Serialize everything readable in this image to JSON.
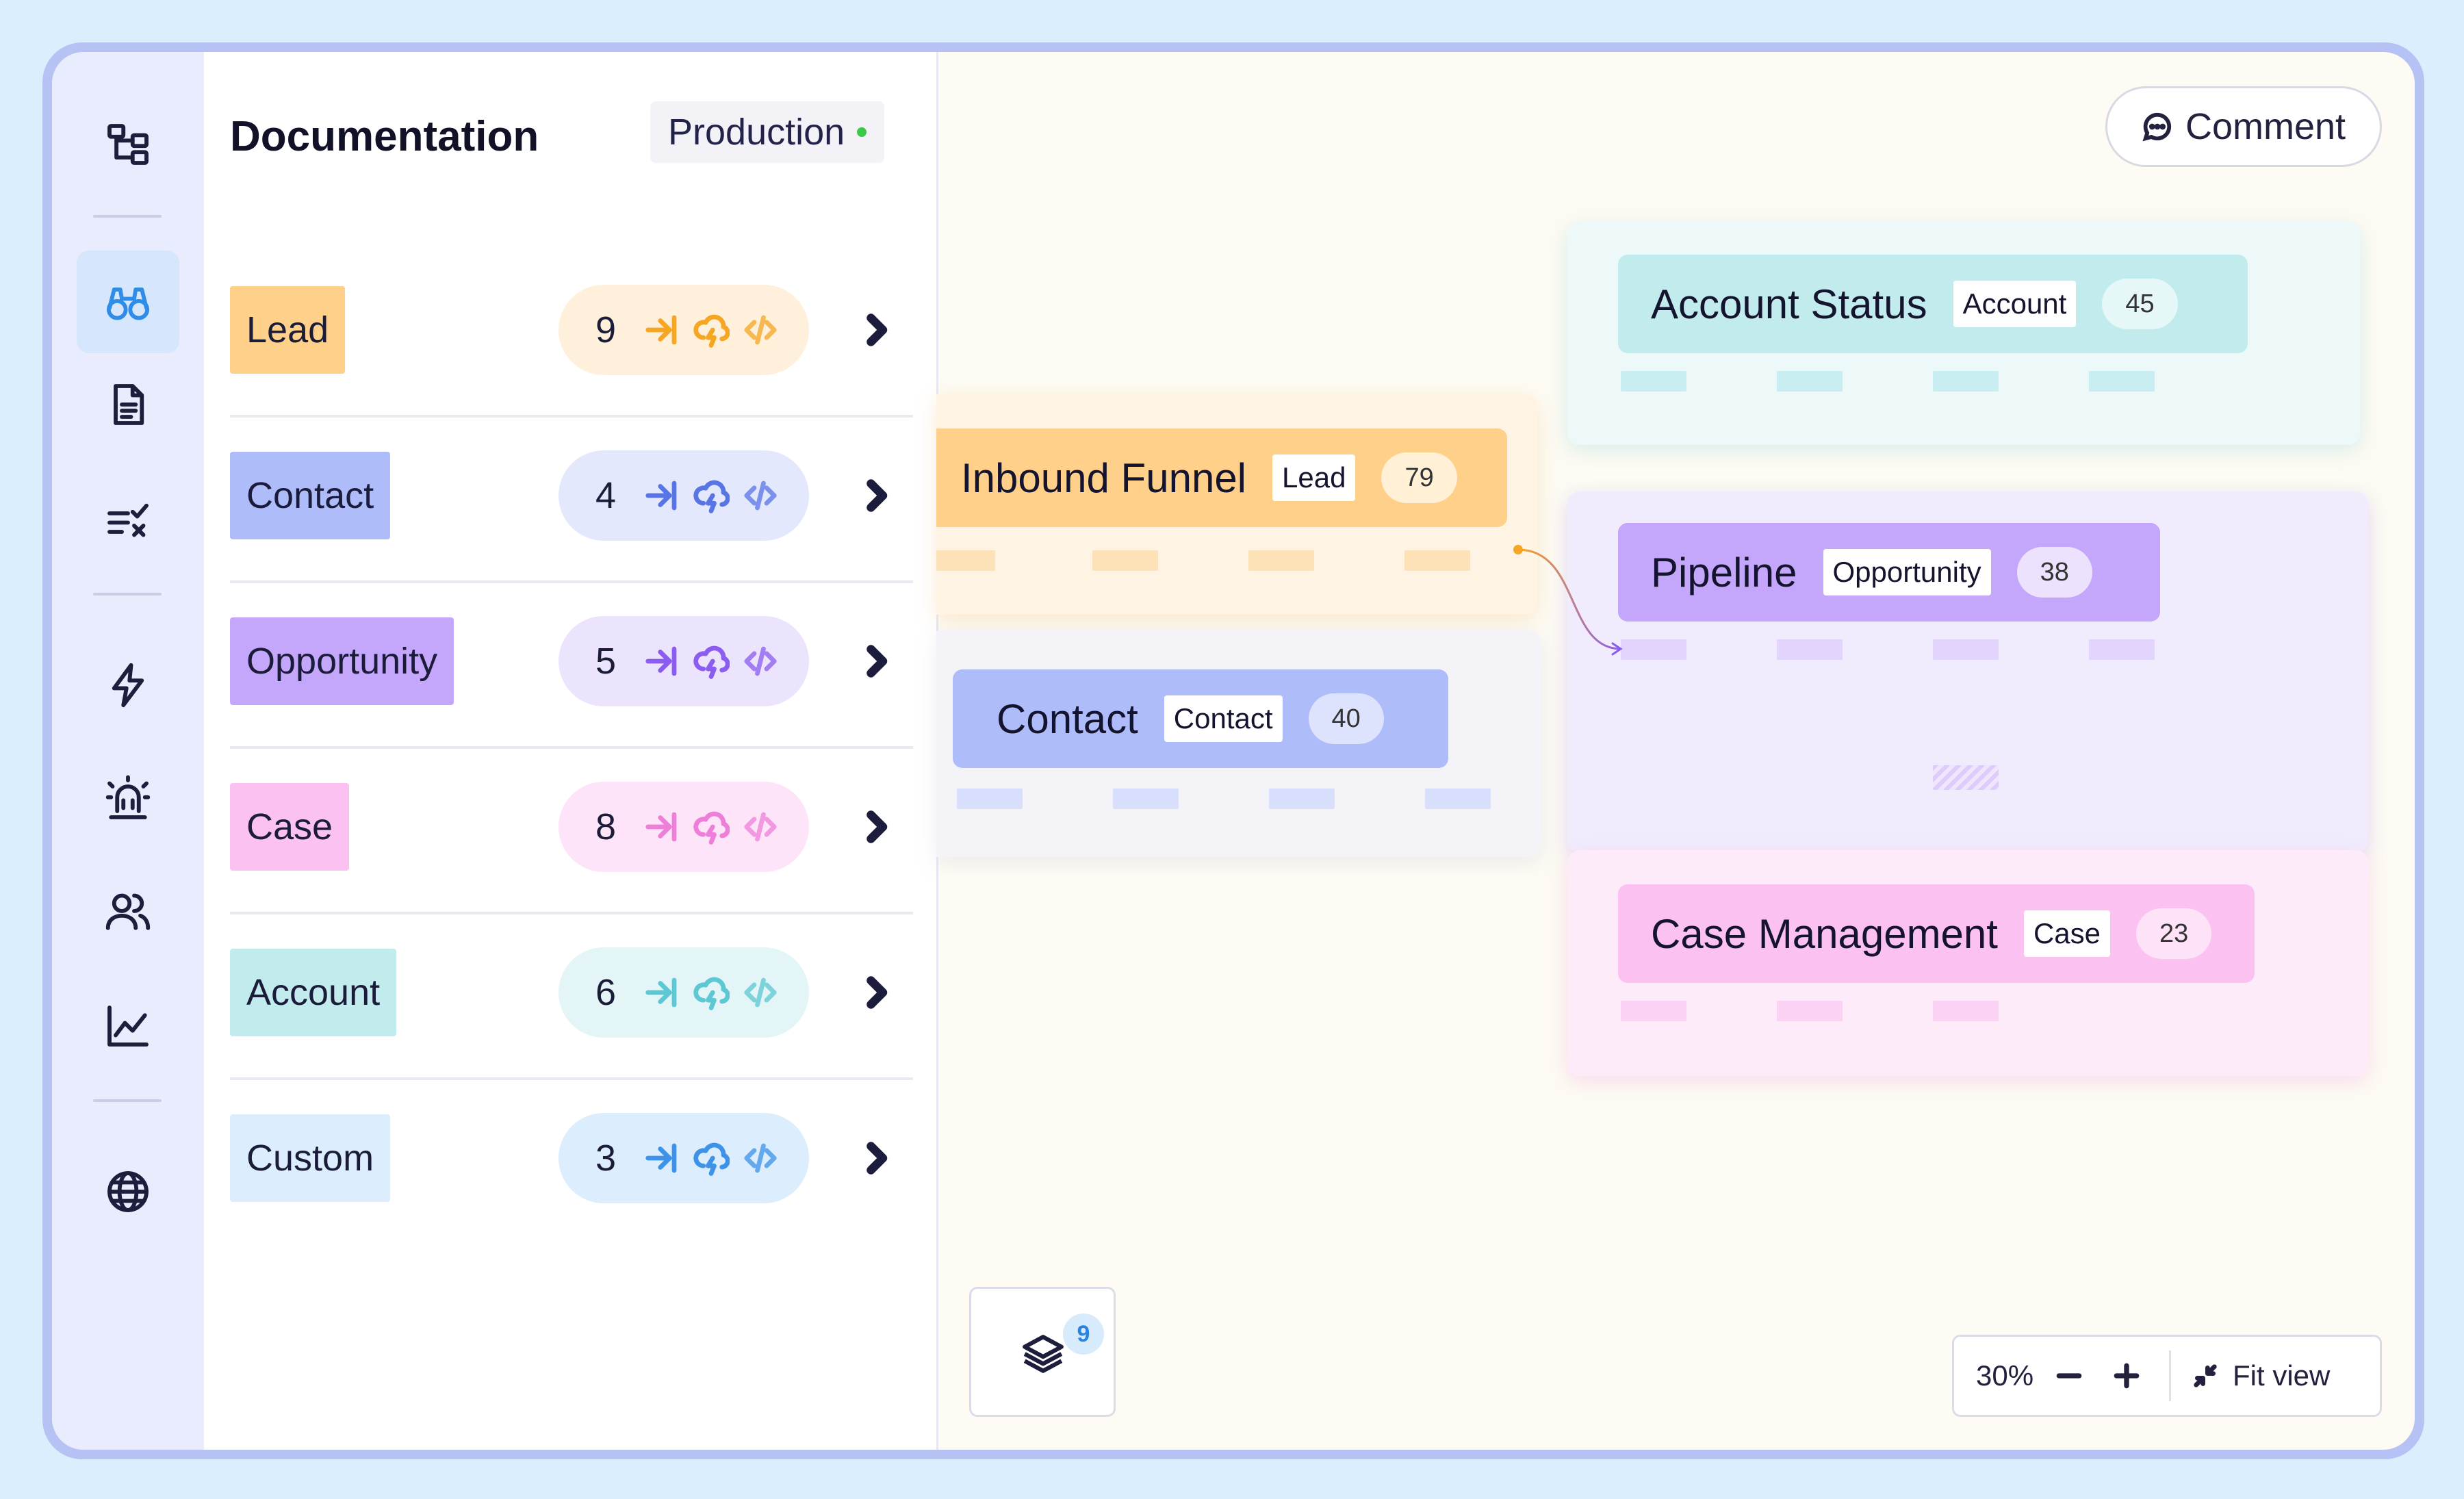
{
  "panel": {
    "title": "Documentation",
    "environment": "Production",
    "rows": [
      {
        "label": "Lead",
        "count": "9",
        "tag_color": "#fed08a",
        "pill_color": "#fff0dc",
        "icon_color": "#f5a623"
      },
      {
        "label": "Contact",
        "count": "4",
        "tag_color": "#aebcf9",
        "pill_color": "#e4e8fd",
        "icon_color": "#5875e6"
      },
      {
        "label": "Opportunity",
        "count": "5",
        "tag_color": "#c4a6fa",
        "pill_color": "#ece4fd",
        "icon_color": "#8b5cf0"
      },
      {
        "label": "Case",
        "count": "8",
        "tag_color": "#fbc1f1",
        "pill_color": "#fde4f8",
        "icon_color": "#ee7fd9"
      },
      {
        "label": "Account",
        "count": "6",
        "tag_color": "#c2ebee",
        "pill_color": "#e3f5f6",
        "icon_color": "#5dc8d3"
      },
      {
        "label": "Custom",
        "count": "3",
        "tag_color": "#dcedfd",
        "pill_color": "#dcedfd",
        "icon_color": "#3e93e8"
      }
    ]
  },
  "canvas": {
    "comment_label": "Comment",
    "nodes": {
      "account_status": {
        "name": "Account Status",
        "tag": "Account",
        "count": "45"
      },
      "inbound_funnel": {
        "name": "Inbound Funnel",
        "tag": "Lead",
        "count": "79"
      },
      "pipeline": {
        "name": "Pipeline",
        "tag": "Opportunity",
        "count": "38"
      },
      "contact": {
        "name": "Contact",
        "tag": "Contact",
        "count": "40"
      },
      "case_management": {
        "name": "Case Management",
        "tag": "Case",
        "count": "23"
      }
    },
    "layers_badge": "9",
    "zoom": {
      "level": "30%",
      "fit_label": "Fit view"
    }
  }
}
